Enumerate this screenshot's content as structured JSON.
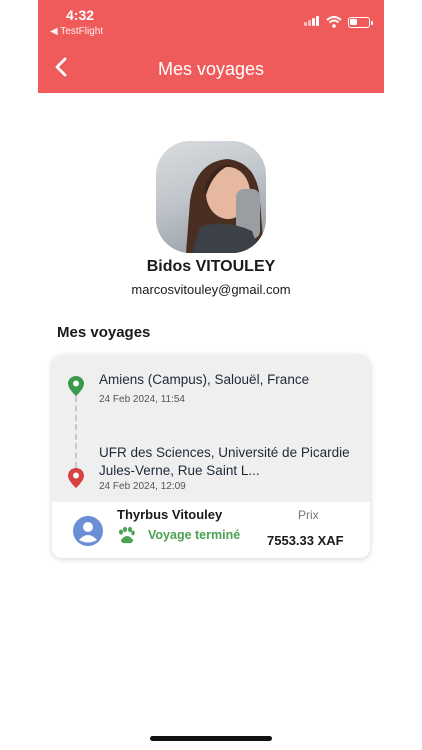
{
  "status_bar": {
    "time": "4:32",
    "back_app": "◀ TestFlight"
  },
  "header": {
    "title": "Mes voyages",
    "back_icon": "chevron-left-icon"
  },
  "profile": {
    "name": "Bidos VITOULEY",
    "email": "marcosvitouley@gmail.com"
  },
  "section": {
    "title": "Mes voyages"
  },
  "trip": {
    "origin": {
      "address": "Amiens (Campus), Salouël, France",
      "datetime": "24 Feb 2024, 11:54"
    },
    "destination": {
      "address": "UFR des Sciences, Université de Picardie Jules-Verne, Rue Saint L...",
      "datetime": "24 Feb 2024, 12:09"
    },
    "driver": "Thyrbus Vitouley",
    "status": "Voyage terminé",
    "price_label": "Prix",
    "price": "7553.33 XAF"
  },
  "colors": {
    "header": "#ef5b5b",
    "status_green": "#4aa252",
    "origin_pin": "#3c9a4b",
    "destination_pin": "#d64242",
    "driver_avatar": "#6a8fd6"
  }
}
